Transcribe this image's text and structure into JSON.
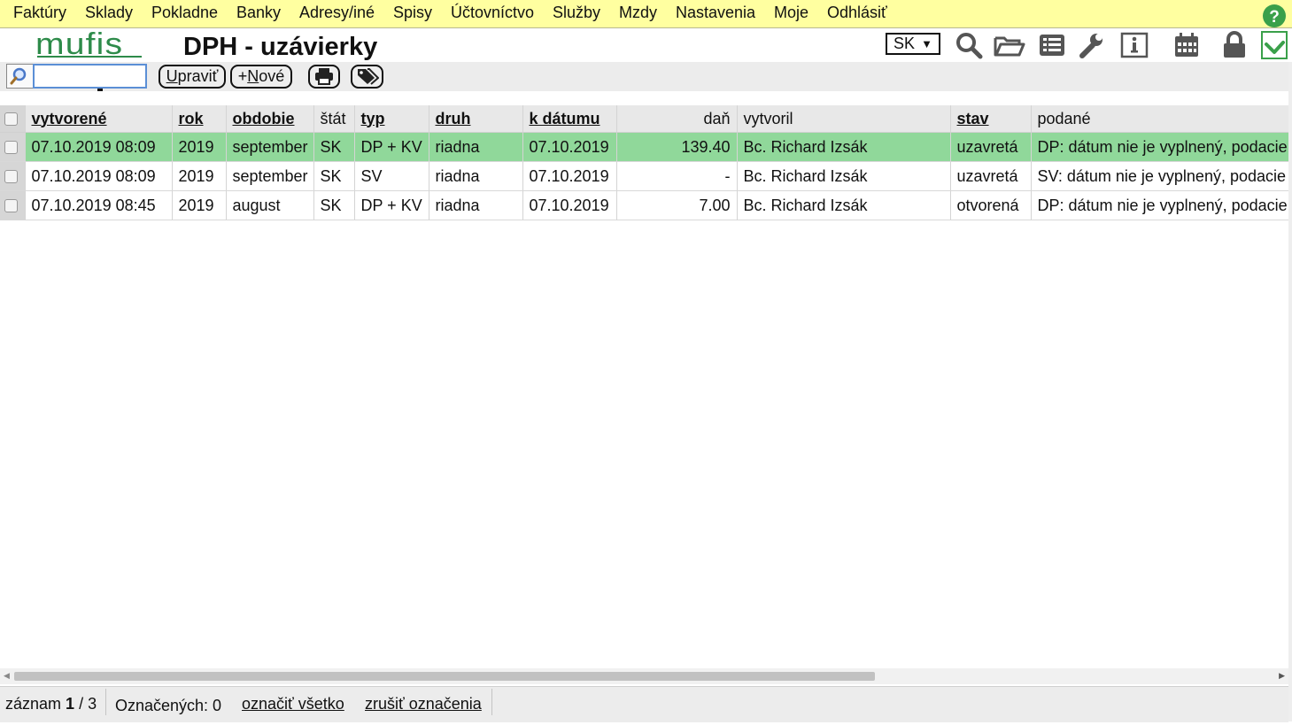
{
  "menu": [
    "Faktúry",
    "Sklady",
    "Pokladne",
    "Banky",
    "Adresy/iné",
    "Spisy",
    "Účtovníctvo",
    "Služby",
    "Mzdy",
    "Nastavenia",
    "Moje",
    "Odhlásiť"
  ],
  "logo_text": "mufis",
  "page_title": "DPH - uzávierky",
  "language": {
    "value": "SK"
  },
  "toolbar": {
    "search_value": "",
    "edit_key": "U",
    "edit_rest": "praviť",
    "new_prefix": "+",
    "new_key": "N",
    "new_rest": "ové"
  },
  "table": {
    "columns": [
      "vytvorené",
      "rok",
      "obdobie",
      "štát",
      "typ",
      "druh",
      "k dátumu",
      "daň",
      "vytvoril",
      "stav",
      "podané"
    ],
    "rows": [
      [
        "07.10.2019 08:09",
        "2019",
        "september",
        "SK",
        "DP + KV",
        "riadna",
        "07.10.2019",
        "139.40",
        "Bc. Richard Izsák",
        "uzavretá",
        "DP: dátum nie je vyplnený, podacie"
      ],
      [
        "07.10.2019 08:09",
        "2019",
        "september",
        "SK",
        "SV",
        "riadna",
        "07.10.2019",
        "-",
        "Bc. Richard Izsák",
        "uzavretá",
        "SV: dátum nie je vyplnený, podacie"
      ],
      [
        "07.10.2019 08:45",
        "2019",
        "august",
        "SK",
        "DP + KV",
        "riadna",
        "07.10.2019",
        "7.00",
        "Bc. Richard Izsák",
        "otvorená",
        "DP: dátum nie je vyplnený, podacie"
      ]
    ],
    "selected_row": 0
  },
  "footer": {
    "record_label": "záznam",
    "record_current": "1",
    "record_total": "/ 3",
    "marked_label": "Označených: 0",
    "mark_all": "označiť všetko",
    "unmark_all": "zrušiť označenia"
  },
  "colors": {
    "menubar": "#ffffa0",
    "selected_row": "#90d89a",
    "logo": "#2e8b4a",
    "check": "#3aa04a"
  },
  "icons": [
    "help-icon",
    "check-icon",
    "search-icon",
    "folder-open-icon",
    "list-icon",
    "wrench-icon",
    "info-icon",
    "calendar-icon",
    "lock-icon",
    "print-icon",
    "tags-icon",
    "magnifier-icon"
  ]
}
